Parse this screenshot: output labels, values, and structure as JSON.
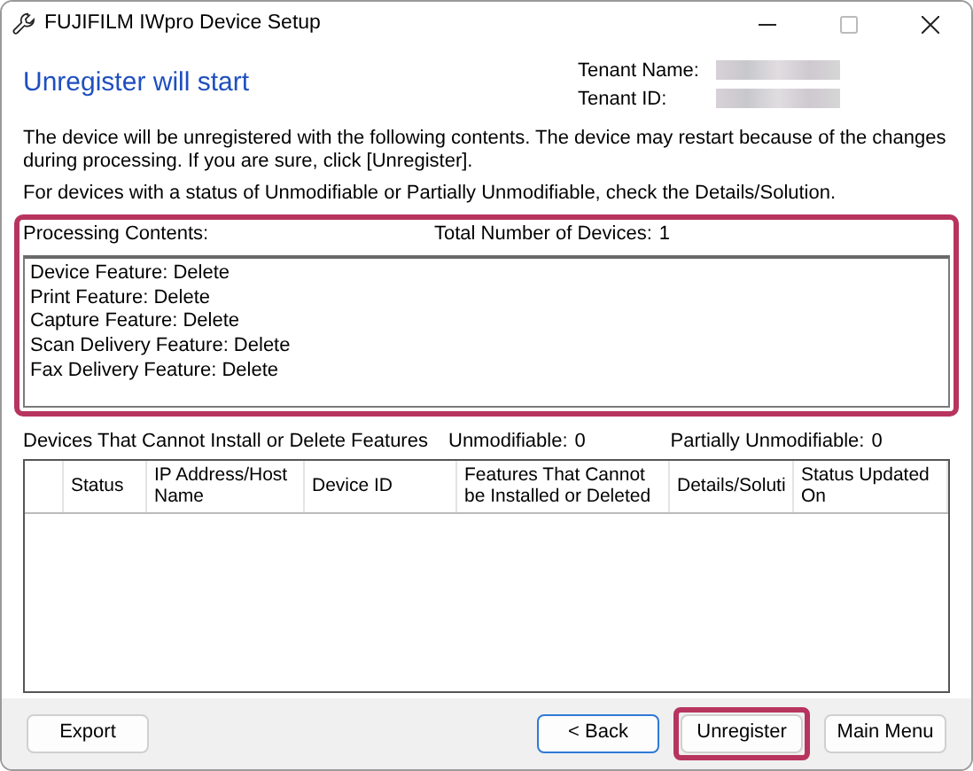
{
  "window": {
    "title": "FUJIFILM IWpro Device Setup"
  },
  "heading": "Unregister will start",
  "tenant": [
    {
      "label": "Tenant Name:"
    },
    {
      "label": "Tenant ID:"
    }
  ],
  "description": [
    "The device will be unregistered with the following contents. The device may restart because of the changes during processing. If you are sure, click [Unregister].",
    "For devices with a status of Unmodifiable or Partially Unmodifiable, check the Details/Solution."
  ],
  "processing": {
    "label": "Processing Contents:",
    "total_label": "Total Number of Devices:",
    "total": "1",
    "highlighted": true,
    "lines": [
      "Device Feature: Delete",
      "Print Feature: Delete",
      "Capture Feature: Delete",
      "Scan Delivery Feature: Delete",
      "Fax Delivery Feature: Delete"
    ]
  },
  "failed": {
    "label": "Devices That Cannot Install or Delete Features",
    "unmodifiable_label": "Unmodifiable:",
    "unmodifiable": "0",
    "partial_label": "Partially Unmodifiable:",
    "partial": "0"
  },
  "table": {
    "columns": [
      "",
      "Status",
      "IP Address/Host Name",
      "Device ID",
      "Features That Cannot be Installed or Deleted",
      "Details/Soluti",
      "Status Updated On"
    ]
  },
  "left_buttons": [
    {
      "label": "Export",
      "focused": false,
      "highlighted": false
    }
  ],
  "buttons": [
    {
      "label": "< Back",
      "focused": true,
      "highlighted": false
    },
    {
      "label": "Unregister",
      "focused": false,
      "highlighted": true
    },
    {
      "label": "Main Menu",
      "focused": false,
      "highlighted": false
    }
  ]
}
